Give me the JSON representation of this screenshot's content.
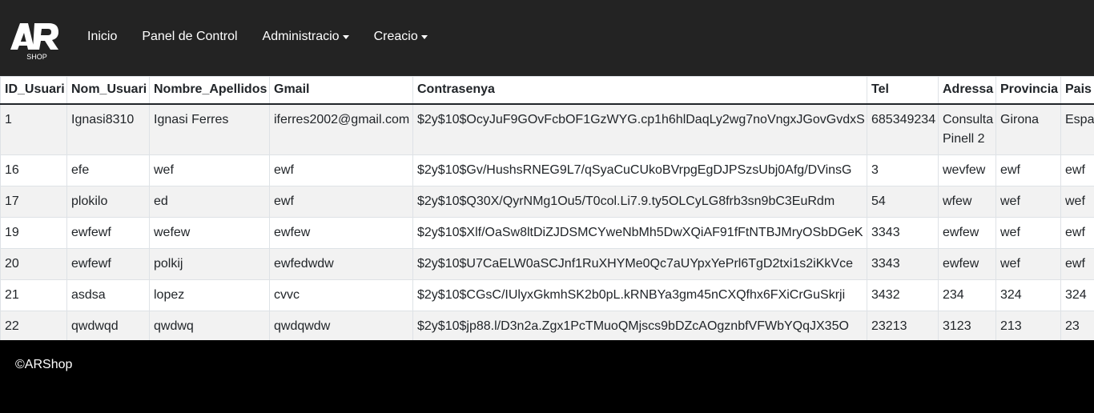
{
  "brand": {
    "logo_text": "AR",
    "logo_subtext": "SHOP"
  },
  "nav": {
    "items": [
      {
        "label": "Inicio",
        "dropdown": false
      },
      {
        "label": "Panel de Control",
        "dropdown": false
      },
      {
        "label": "Administracio",
        "dropdown": true
      },
      {
        "label": "Creacio",
        "dropdown": true
      }
    ]
  },
  "table": {
    "headers": [
      "ID_Usuari",
      "Nom_Usuari",
      "Nombre_Apellidos",
      "Gmail",
      "Contrasenya",
      "Tel",
      "Adressa",
      "Provincia",
      "Pais"
    ],
    "rows": [
      [
        "1",
        "Ignasi8310",
        "Ignasi Ferres",
        "iferres2002@gmail.com",
        "$2y$10$OcyJuF9GOvFcbOF1GzWYG.cp1h6hlDaqLy2wg7noVngxJGovGvdxS",
        "685349234",
        "Consulta Pinell 2",
        "Girona",
        "Espanya"
      ],
      [
        "16",
        "efe",
        "wef",
        "ewf",
        "$2y$10$Gv/HushsRNEG9L7/qSyaCuCUkoBVrpgEgDJPSzsUbj0Afg/DVinsG",
        "3",
        "wevfew",
        "ewf",
        "ewf"
      ],
      [
        "17",
        "plokilo",
        "ed",
        "ewf",
        "$2y$10$Q30X/QyrNMg1Ou5/T0col.Li7.9.ty5OLCyLG8frb3sn9bC3EuRdm",
        "54",
        "wfew",
        "wef",
        "wef"
      ],
      [
        "19",
        "ewfewf",
        "wefew",
        "ewfew",
        "$2y$10$Xlf/OaSw8ltDiZJDSMCYweNbMh5DwXQiAF91fFtNTBJMryOSbDGeK",
        "3343",
        "ewfew",
        "wef",
        "ewf"
      ],
      [
        "20",
        "ewfewf",
        "polkij",
        "ewfedwdw",
        "$2y$10$U7CaELW0aSCJnf1RuXHYMe0Qc7aUYpxYePrl6TgD2txi1s2iKkVce",
        "3343",
        "ewfew",
        "wef",
        "ewf"
      ],
      [
        "21",
        "asdsa",
        "lopez",
        "cvvc",
        "$2y$10$CGsC/IUlyxGkmhSK2b0pL.kRNBYa3gm45nCXQfhx6FXiCrGuSkrji",
        "3432",
        "234",
        "324",
        "324"
      ],
      [
        "22",
        "qwdwqd",
        "qwdwq",
        "qwdqwdw",
        "$2y$10$jp88.l/D3n2a.Zgx1PcTMuoQMjscs9bDZcAOgznbfVFWbYQqJX35O",
        "23213",
        "3123",
        "213",
        "23"
      ]
    ]
  },
  "footer": {
    "text": "©ARShop"
  }
}
